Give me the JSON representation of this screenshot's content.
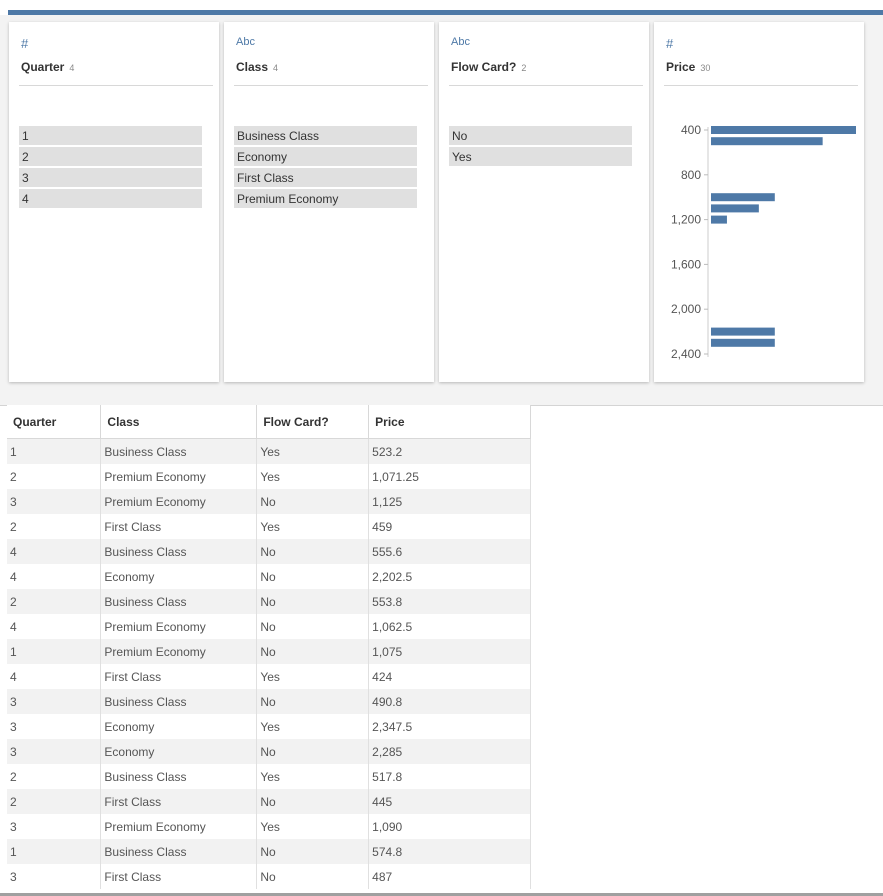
{
  "colors": {
    "accent": "#4e79a7",
    "card_bg": "#ffffff",
    "chip_bg": "#e0e0e0"
  },
  "profile_cards": [
    {
      "icon": "#",
      "icon_name": "number-type-icon",
      "title": "Quarter",
      "count": "4",
      "values": [
        "1",
        "2",
        "3",
        "4"
      ]
    },
    {
      "icon": "Abc",
      "icon_name": "string-type-icon",
      "title": "Class",
      "count": "4",
      "values": [
        "Business Class",
        "Economy",
        "First Class",
        "Premium Economy"
      ]
    },
    {
      "icon": "Abc",
      "icon_name": "string-type-icon",
      "title": "Flow Card?",
      "count": "2",
      "values": [
        "No",
        "Yes"
      ]
    },
    {
      "icon": "#",
      "icon_name": "number-type-icon",
      "title": "Price",
      "count": "30"
    }
  ],
  "chart_data": {
    "type": "bar",
    "orientation": "horizontal",
    "axis_ticks": [
      "400",
      "800",
      "1,200",
      "1,600",
      "2,000",
      "2,400"
    ],
    "bins": [
      {
        "start": 400,
        "relative_count": 1.0
      },
      {
        "start": 500,
        "relative_count": 0.77
      },
      {
        "start": 1000,
        "relative_count": 0.44
      },
      {
        "start": 1100,
        "relative_count": 0.33
      },
      {
        "start": 1200,
        "relative_count": 0.11
      },
      {
        "start": 2200,
        "relative_count": 0.44
      },
      {
        "start": 2300,
        "relative_count": 0.44
      }
    ]
  },
  "table": {
    "columns": [
      "Quarter",
      "Class",
      "Flow Card?",
      "Price"
    ],
    "rows": [
      [
        "1",
        "Business Class",
        "Yes",
        "523.2"
      ],
      [
        "2",
        "Premium Economy",
        "Yes",
        "1,071.25"
      ],
      [
        "3",
        "Premium Economy",
        "No",
        "1,125"
      ],
      [
        "2",
        "First Class",
        "Yes",
        "459"
      ],
      [
        "4",
        "Business Class",
        "No",
        "555.6"
      ],
      [
        "4",
        "Economy",
        "No",
        "2,202.5"
      ],
      [
        "2",
        "Business Class",
        "No",
        "553.8"
      ],
      [
        "4",
        "Premium Economy",
        "No",
        "1,062.5"
      ],
      [
        "1",
        "Premium Economy",
        "No",
        "1,075"
      ],
      [
        "4",
        "First Class",
        "Yes",
        "424"
      ],
      [
        "3",
        "Business Class",
        "No",
        "490.8"
      ],
      [
        "3",
        "Economy",
        "Yes",
        "2,347.5"
      ],
      [
        "3",
        "Economy",
        "No",
        "2,285"
      ],
      [
        "2",
        "Business Class",
        "Yes",
        "517.8"
      ],
      [
        "2",
        "First Class",
        "No",
        "445"
      ],
      [
        "3",
        "Premium Economy",
        "Yes",
        "1,090"
      ],
      [
        "1",
        "Business Class",
        "No",
        "574.8"
      ],
      [
        "3",
        "First Class",
        "No",
        "487"
      ]
    ]
  }
}
